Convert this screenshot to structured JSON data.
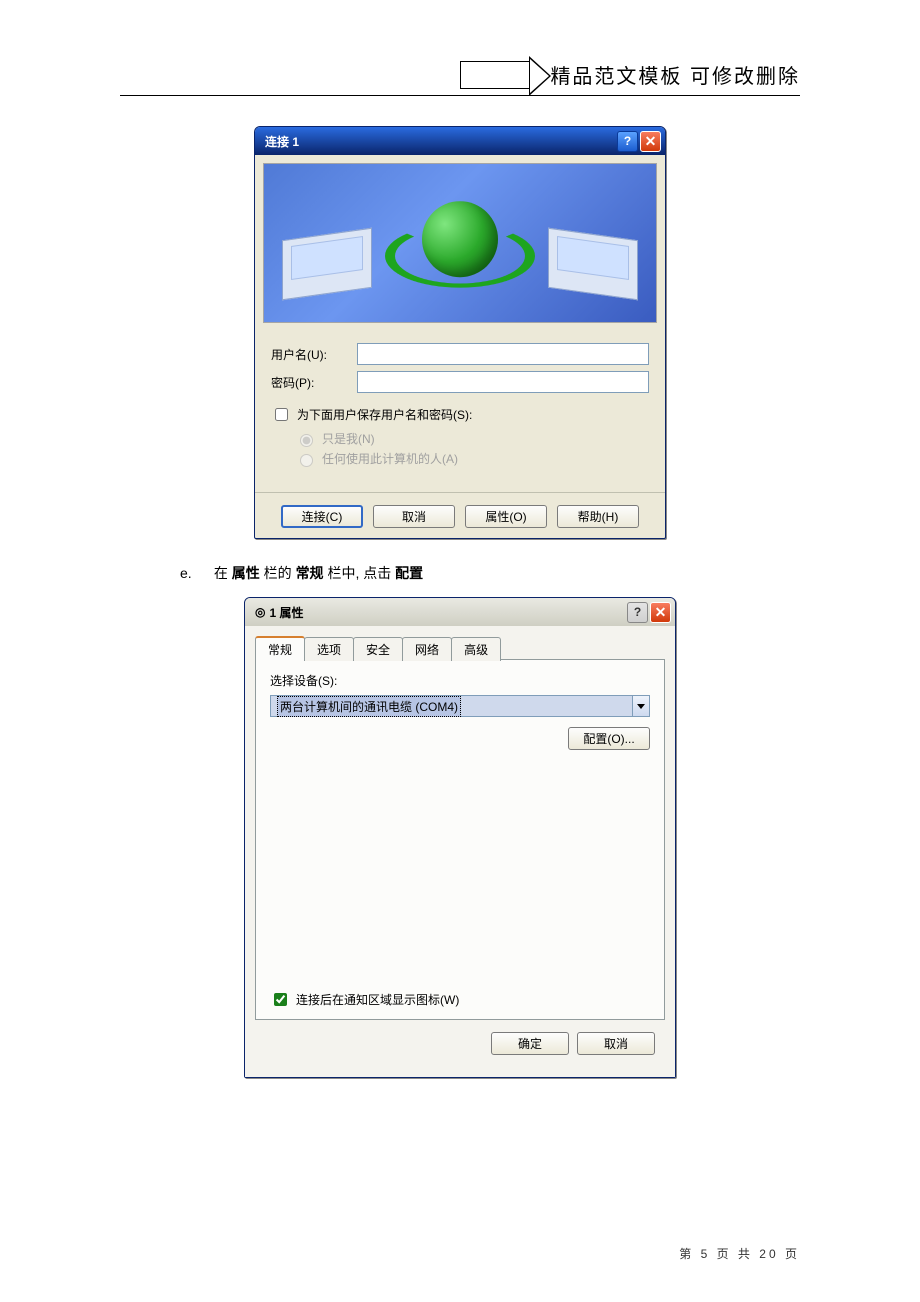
{
  "header": {
    "title": "精品范文模板  可修改删除"
  },
  "dialog1": {
    "title": "连接 1",
    "username_label": "用户名(U):",
    "password_label": "密码(P):",
    "save_label": "为下面用户保存用户名和密码(S):",
    "radio_me": "只是我(N)",
    "radio_all": "任何使用此计算机的人(A)",
    "buttons": {
      "connect": "连接(C)",
      "cancel": "取消",
      "props": "属性(O)",
      "help": "帮助(H)"
    }
  },
  "step": {
    "marker": "e.",
    "prefix": "在 ",
    "bold1": "属性",
    "mid1": " 栏的",
    "bold2": "常规",
    "mid2": " 栏中, 点击",
    "bold3": "配置"
  },
  "dialog2": {
    "title": "1 属性",
    "tabs": [
      "常规",
      "选项",
      "安全",
      "网络",
      "高级"
    ],
    "active_tab_index": 0,
    "device_label": "选择设备(S):",
    "device_value": "两台计算机间的通讯电缆 (COM4)",
    "configure_btn": "配置(O)...",
    "show_icon_label": "连接后在通知区域显示图标(W)",
    "ok_btn": "确定",
    "cancel_btn": "取消"
  },
  "footer": {
    "p1": "第",
    "cur": "5",
    "p2": "页 共",
    "total": "20",
    "p3": "页"
  }
}
